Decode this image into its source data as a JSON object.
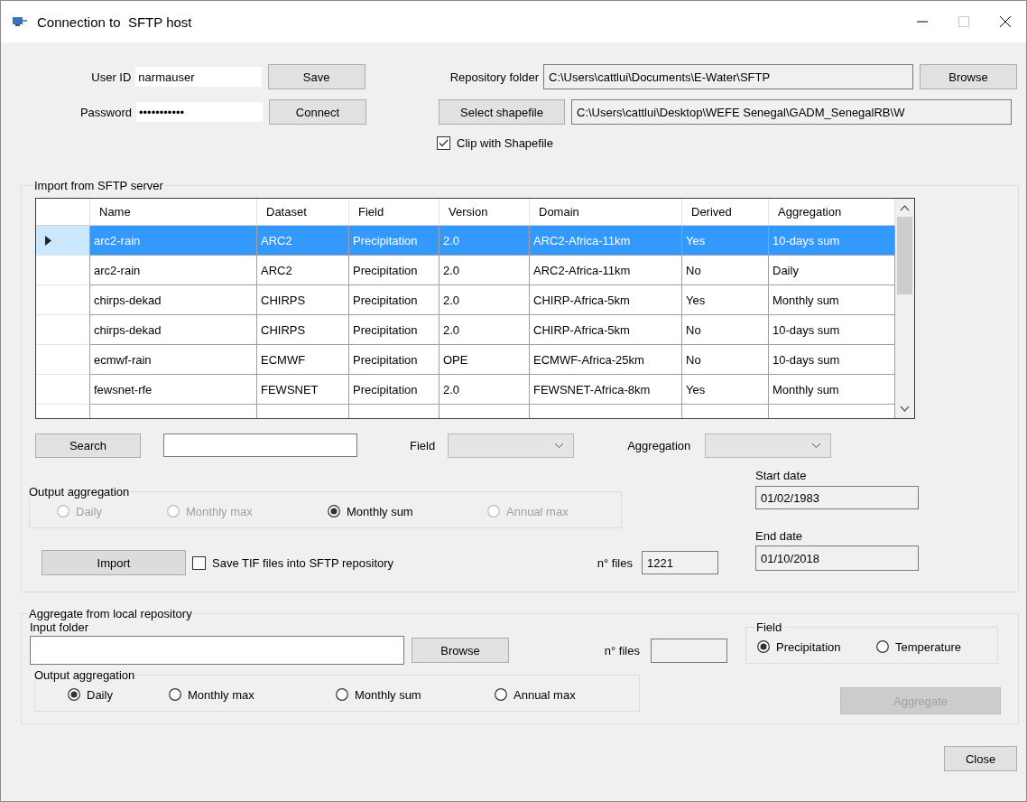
{
  "window": {
    "title": "Connection to  SFTP host"
  },
  "login": {
    "user_id": {
      "label": "User ID",
      "value": "narmauser"
    },
    "password": {
      "label": "Password",
      "value": "•••••••••••"
    },
    "save_button": "Save",
    "connect_button": "Connect"
  },
  "repository": {
    "label": "Repository folder",
    "value": "C:\\Users\\cattlui\\Documents\\E-Water\\SFTP",
    "browse_button": "Browse"
  },
  "shapefile": {
    "button": "Select shapefile",
    "value": "C:\\Users\\cattlui\\Desktop\\WEFE Senegal\\GADM_SenegalRB\\W",
    "clip": {
      "label": "Clip with Shapefile",
      "checked": true
    }
  },
  "import": {
    "title": "Import from SFTP server",
    "table": {
      "columns": [
        "Name",
        "Dataset",
        "Field",
        "Version",
        "Domain",
        "Derived",
        "Aggregation"
      ],
      "rows": [
        {
          "cells": [
            "arc2-rain",
            "ARC2",
            "Precipitation",
            "2.0",
            "ARC2-Africa-11km",
            "Yes",
            "10-days sum"
          ],
          "selected": true
        },
        {
          "cells": [
            "arc2-rain",
            "ARC2",
            "Precipitation",
            "2.0",
            "ARC2-Africa-11km",
            "No",
            "Daily"
          ],
          "selected": false
        },
        {
          "cells": [
            "chirps-dekad",
            "CHIRPS",
            "Precipitation",
            "2.0",
            "CHIRP-Africa-5km",
            "Yes",
            "Monthly sum"
          ],
          "selected": false
        },
        {
          "cells": [
            "chirps-dekad",
            "CHIRPS",
            "Precipitation",
            "2.0",
            "CHIRP-Africa-5km",
            "No",
            "10-days sum"
          ],
          "selected": false
        },
        {
          "cells": [
            "ecmwf-rain",
            "ECMWF",
            "Precipitation",
            "OPE",
            "ECMWF-Africa-25km",
            "No",
            "10-days sum"
          ],
          "selected": false
        },
        {
          "cells": [
            "fewsnet-rfe",
            "FEWSNET",
            "Precipitation",
            "2.0",
            "FEWSNET-Africa-8km",
            "Yes",
            "Monthly sum"
          ],
          "selected": false
        }
      ]
    },
    "search_button": "Search",
    "field_filter": {
      "label": "Field",
      "disabled": true
    },
    "aggregation_filter": {
      "label": "Aggregation",
      "disabled": true
    },
    "output_aggregation": {
      "title": "Output aggregation",
      "options": [
        {
          "label": "Daily",
          "selected": false,
          "disabled": true
        },
        {
          "label": "Monthly max",
          "selected": false,
          "disabled": true
        },
        {
          "label": "Monthly sum",
          "selected": true,
          "disabled": false
        },
        {
          "label": "Annual max",
          "selected": false,
          "disabled": true
        }
      ]
    },
    "start_date": {
      "label": "Start date",
      "value": "01/02/1983"
    },
    "end_date": {
      "label": "End date",
      "value": "01/10/2018"
    },
    "import_button": "Import",
    "save_tif": {
      "label": "Save TIF files into SFTP repository",
      "checked": false
    },
    "n_files": {
      "label": "n° files",
      "value": "1221"
    }
  },
  "aggregate": {
    "title": "Aggregate from local repository",
    "input_folder": {
      "label": "Input folder"
    },
    "browse_button": "Browse",
    "n_files": {
      "label": "n° files"
    },
    "field": {
      "title": "Field",
      "options": [
        {
          "label": "Precipitation",
          "selected": true
        },
        {
          "label": "Temperature",
          "selected": false
        }
      ]
    },
    "output_aggregation": {
      "title": "Output aggregation",
      "options": [
        {
          "label": "Daily",
          "selected": true,
          "disabled": false
        },
        {
          "label": "Monthly max",
          "selected": false,
          "disabled": false
        },
        {
          "label": "Monthly sum",
          "selected": false,
          "disabled": false
        },
        {
          "label": "Annual max",
          "selected": false,
          "disabled": false
        }
      ]
    },
    "aggregate_button": {
      "label": "Aggregate",
      "disabled": true
    }
  },
  "close_button": "Close"
}
